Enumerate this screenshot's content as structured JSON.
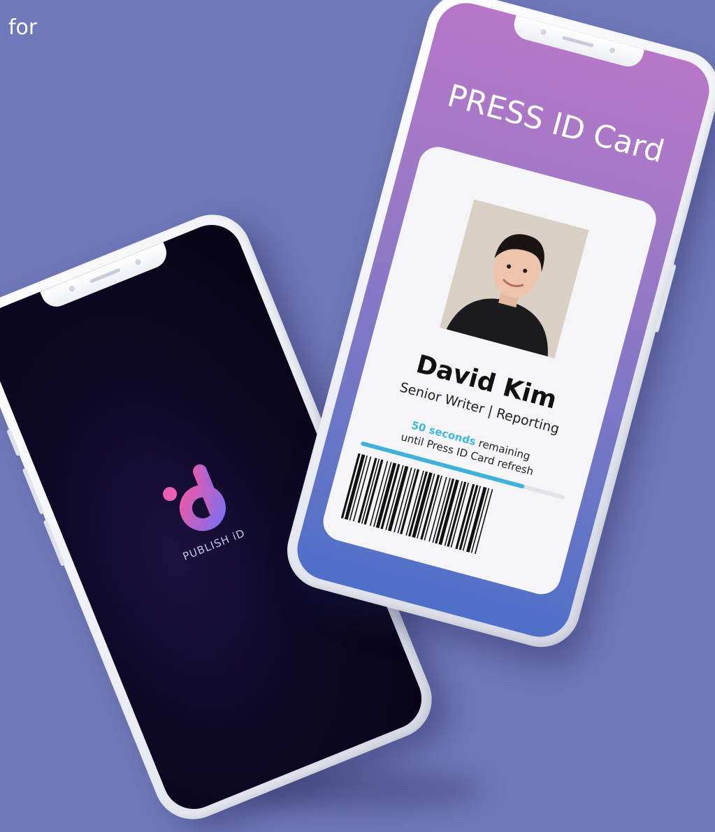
{
  "header": {
    "corner_text": "for"
  },
  "splash_phone": {
    "logo_text": "PUBLISH iD",
    "logo_icon": "publish-id-logo-icon",
    "colors": {
      "logo_gradient_start": "#e85aa8",
      "logo_gradient_end": "#7f6ef0",
      "screen_bg": "#0d0826"
    }
  },
  "card_phone": {
    "title": "PRESS ID Card",
    "name": "David Kim",
    "role": "Senior Writer",
    "role_separator": "|",
    "department": "Reporting",
    "refresh": {
      "seconds_text": "50 seconds",
      "remaining_text": "remaining",
      "line2": "until Press ID Card refresh",
      "progress": 0.8
    },
    "photo_icon": "profile-photo",
    "colors": {
      "accent": "#3fb2dc",
      "gradient_top": "#b877c8",
      "gradient_bottom": "#4f6fc8"
    }
  }
}
